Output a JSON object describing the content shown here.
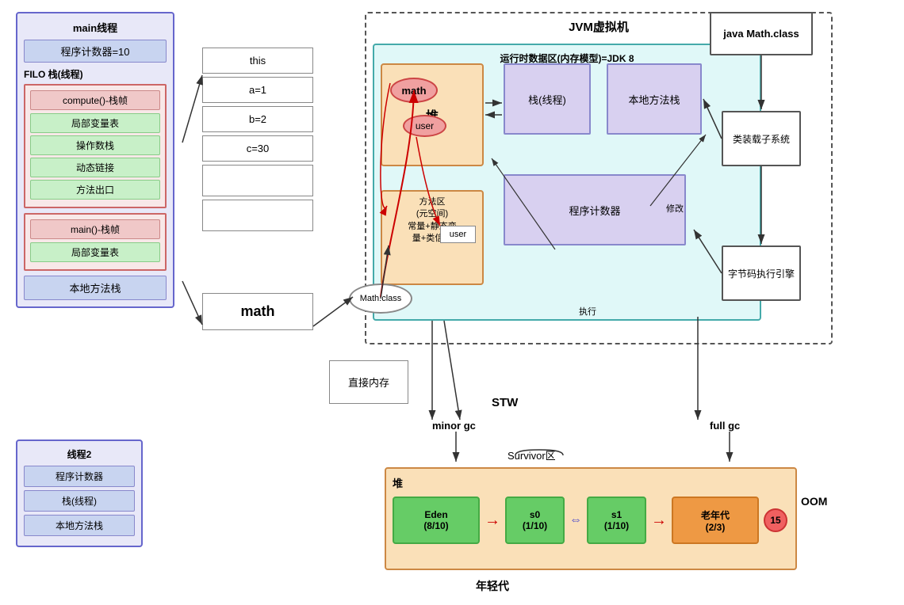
{
  "main_thread": {
    "title": "main线程",
    "counter": "程序计数器=10",
    "filo_label": "FILO 栈(线程)",
    "compute_frame": {
      "title": "compute()-栈帧",
      "items": [
        "局部变量表",
        "操作数栈",
        "动态链接",
        "方法出口"
      ]
    },
    "main_frame": {
      "title": "main()-栈帧",
      "items": [
        "局部变量表"
      ]
    },
    "native_stack": "本地方法栈"
  },
  "thread2": {
    "title": "线程2",
    "items": [
      "程序计数器",
      "栈(线程)",
      "本地方法栈"
    ]
  },
  "stack_frames": {
    "this_label": "this",
    "a_label": "a=1",
    "b_label": "b=2",
    "c_label": "c=30",
    "math_label": "math"
  },
  "direct_memory": {
    "label": "直接内存"
  },
  "jvm": {
    "title": "JVM虚拟机",
    "runtime_title": "运行时数据区(内存模型)=JDK 8",
    "heap_label": "堆",
    "stack_thread_label": "栈(线程)",
    "native_method_label": "本地方法栈",
    "method_area_label": "方法区\n(元空间)\n常量+静态变\n量+类信息",
    "pc_label": "程序计数器"
  },
  "loader_box": "类装载子系统",
  "bytecode_box": "字节码执行引擎",
  "java_math": "java Math.class",
  "math_class_oval": "Math.class",
  "math_oval": "math",
  "user_oval": "user",
  "user_label": "user",
  "stw": "STW",
  "survivor": "Survivor区",
  "heap_bottom": {
    "label": "堆",
    "eden": "Eden\n(8/10)",
    "s0": "s0\n(1/10)",
    "s1": "s1\n(1/10)",
    "old": "老年代\n(2/3)",
    "age": "15",
    "younggen": "年轻代"
  },
  "oom": "OOM",
  "minor_gc": "minor gc",
  "full_gc": "full gc",
  "modify_label": "修改",
  "execute_label": "执行"
}
